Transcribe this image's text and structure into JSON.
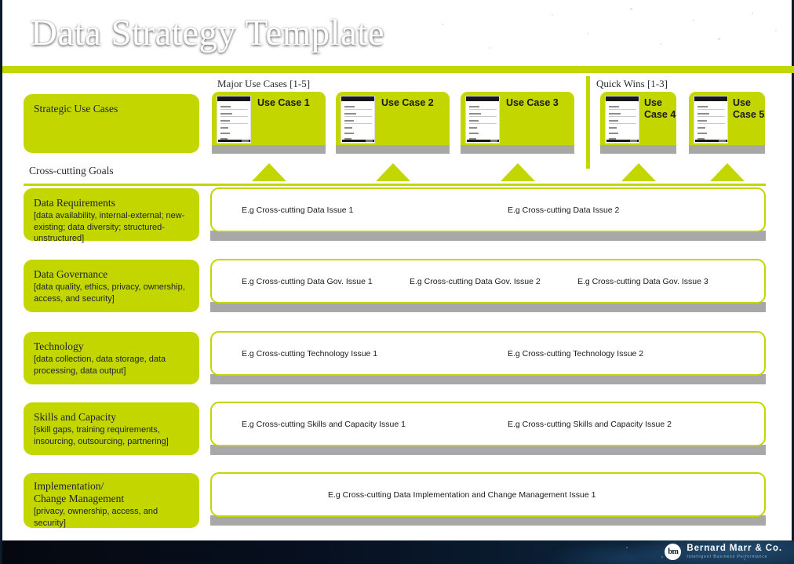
{
  "header": {
    "title": "Data Strategy Template",
    "accent_color": "#c4d600",
    "background_color": "#071020"
  },
  "sections": {
    "major_use_cases_caption": "Major Use Cases [1-5]",
    "quick_wins_caption": "Quick Wins [1-3]",
    "cross_cutting_caption": "Cross-cutting Goals"
  },
  "use_cases": [
    {
      "label": "Use Case 1",
      "group": "major"
    },
    {
      "label": "Use Case 2",
      "group": "major"
    },
    {
      "label": "Use Case 3",
      "group": "major"
    },
    {
      "label": "Use\nCase 4",
      "group": "quick"
    },
    {
      "label": "Use\nCase 5",
      "group": "quick"
    }
  ],
  "rows": [
    {
      "heading": "Strategic Use Cases",
      "sub": "",
      "items": []
    },
    {
      "heading": "Data Requirements",
      "sub": "[data availability, internal-external; new-existing; data diversity; structured-unstructured]",
      "items": [
        "E.g Cross-cutting Data Issue 1",
        "E.g Cross-cutting Data Issue 2"
      ]
    },
    {
      "heading": "Data Governance",
      "sub": "[data quality, ethics, privacy, ownership, access, and security]",
      "items": [
        "E.g Cross-cutting Data Gov. Issue 1",
        "E.g Cross-cutting Data Gov. Issue 2",
        "E.g Cross-cutting Data Gov. Issue 3"
      ]
    },
    {
      "heading": "Technology",
      "sub": "[data collection, data storage, data processing, data output]",
      "items": [
        "E.g Cross-cutting Technology Issue 1",
        "E.g Cross-cutting Technology Issue 2"
      ]
    },
    {
      "heading": "Skills and Capacity",
      "sub": "[skill gaps, training requirements, insourcing, outsourcing, partnering]",
      "items": [
        "E.g Cross-cutting Skills and Capacity Issue 1",
        "E.g Cross-cutting Skills and Capacity Issue 2"
      ]
    },
    {
      "heading": "Implementation/\nChange Management",
      "sub": "[privacy, ownership, access, and security]",
      "items": [
        "E.g Cross-cutting Data Implementation and Change Management Issue 1"
      ]
    }
  ],
  "footer": {
    "logo_mark": "bm",
    "logo_name": "Bernard Marr & Co.",
    "logo_tagline": "Intelligent Business Performance"
  }
}
